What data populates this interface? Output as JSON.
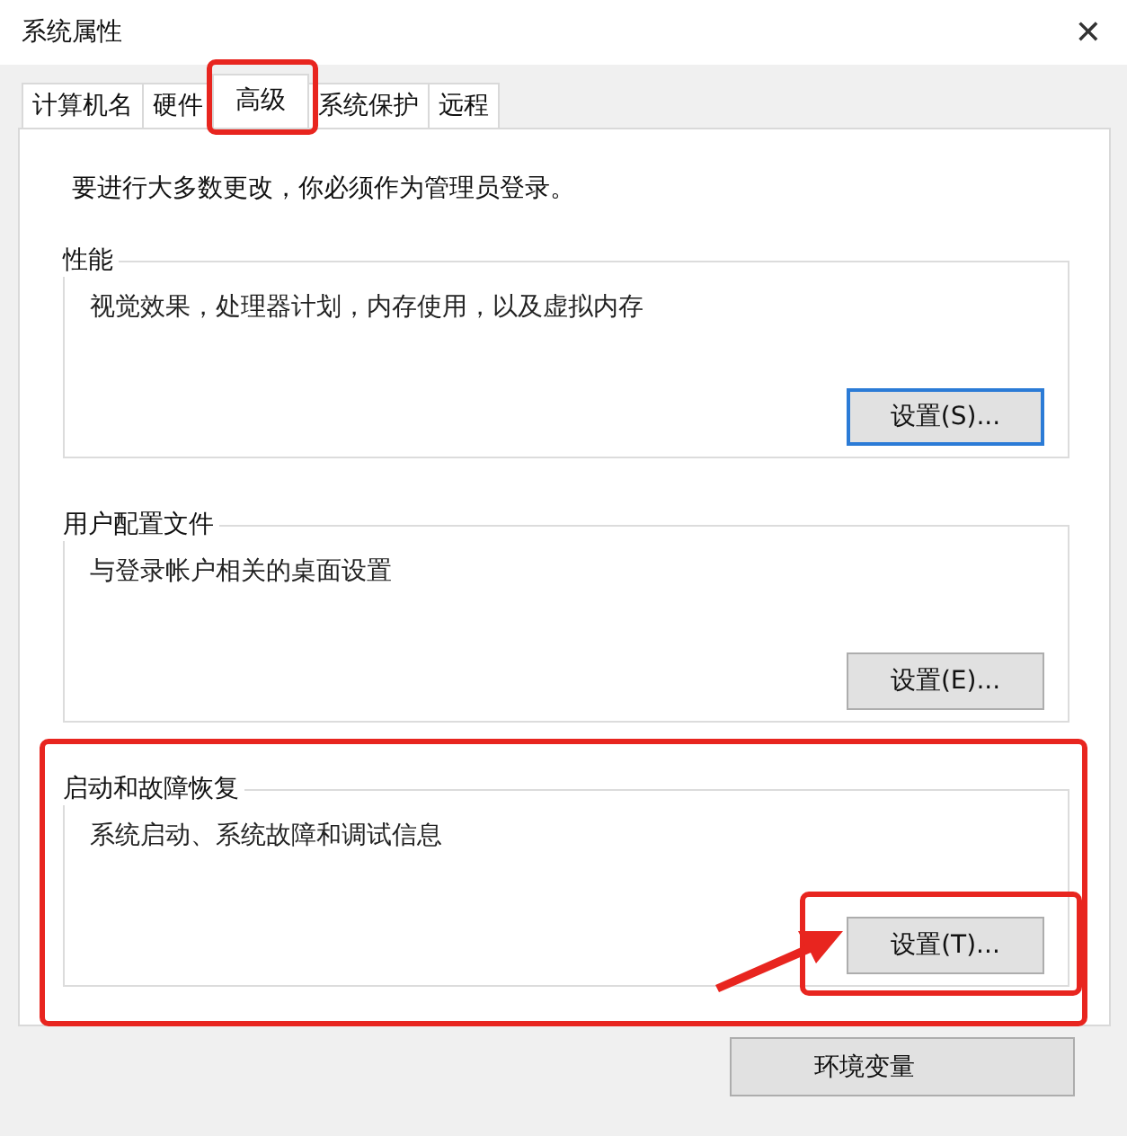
{
  "window": {
    "title": "系统属性",
    "close": "✕"
  },
  "tabs": [
    {
      "label": "计算机名",
      "selected": false
    },
    {
      "label": "硬件",
      "selected": false
    },
    {
      "label": "高级",
      "selected": true,
      "highlighted": true
    },
    {
      "label": "系统保护",
      "selected": false
    },
    {
      "label": "远程",
      "selected": false
    }
  ],
  "notice": "要进行大多数更改，你必须作为管理员登录。",
  "groups": [
    {
      "title": "性能",
      "description": "视觉效果，处理器计划，内存使用，以及虚拟内存",
      "button": {
        "label": "设置(S)...",
        "focused": true
      }
    },
    {
      "title": "用户配置文件",
      "description": "与登录帐户相关的桌面设置",
      "button": {
        "label": "设置(E)...",
        "focused": false
      }
    },
    {
      "title": "启动和故障恢复",
      "description": "系统启动、系统故障和调试信息",
      "highlighted": true,
      "button": {
        "label": "设置(T)...",
        "focused": false,
        "highlighted": true
      }
    }
  ],
  "env_button": {
    "label": "环境变量"
  },
  "annotations": [
    {
      "kind": "arrow"
    }
  ]
}
